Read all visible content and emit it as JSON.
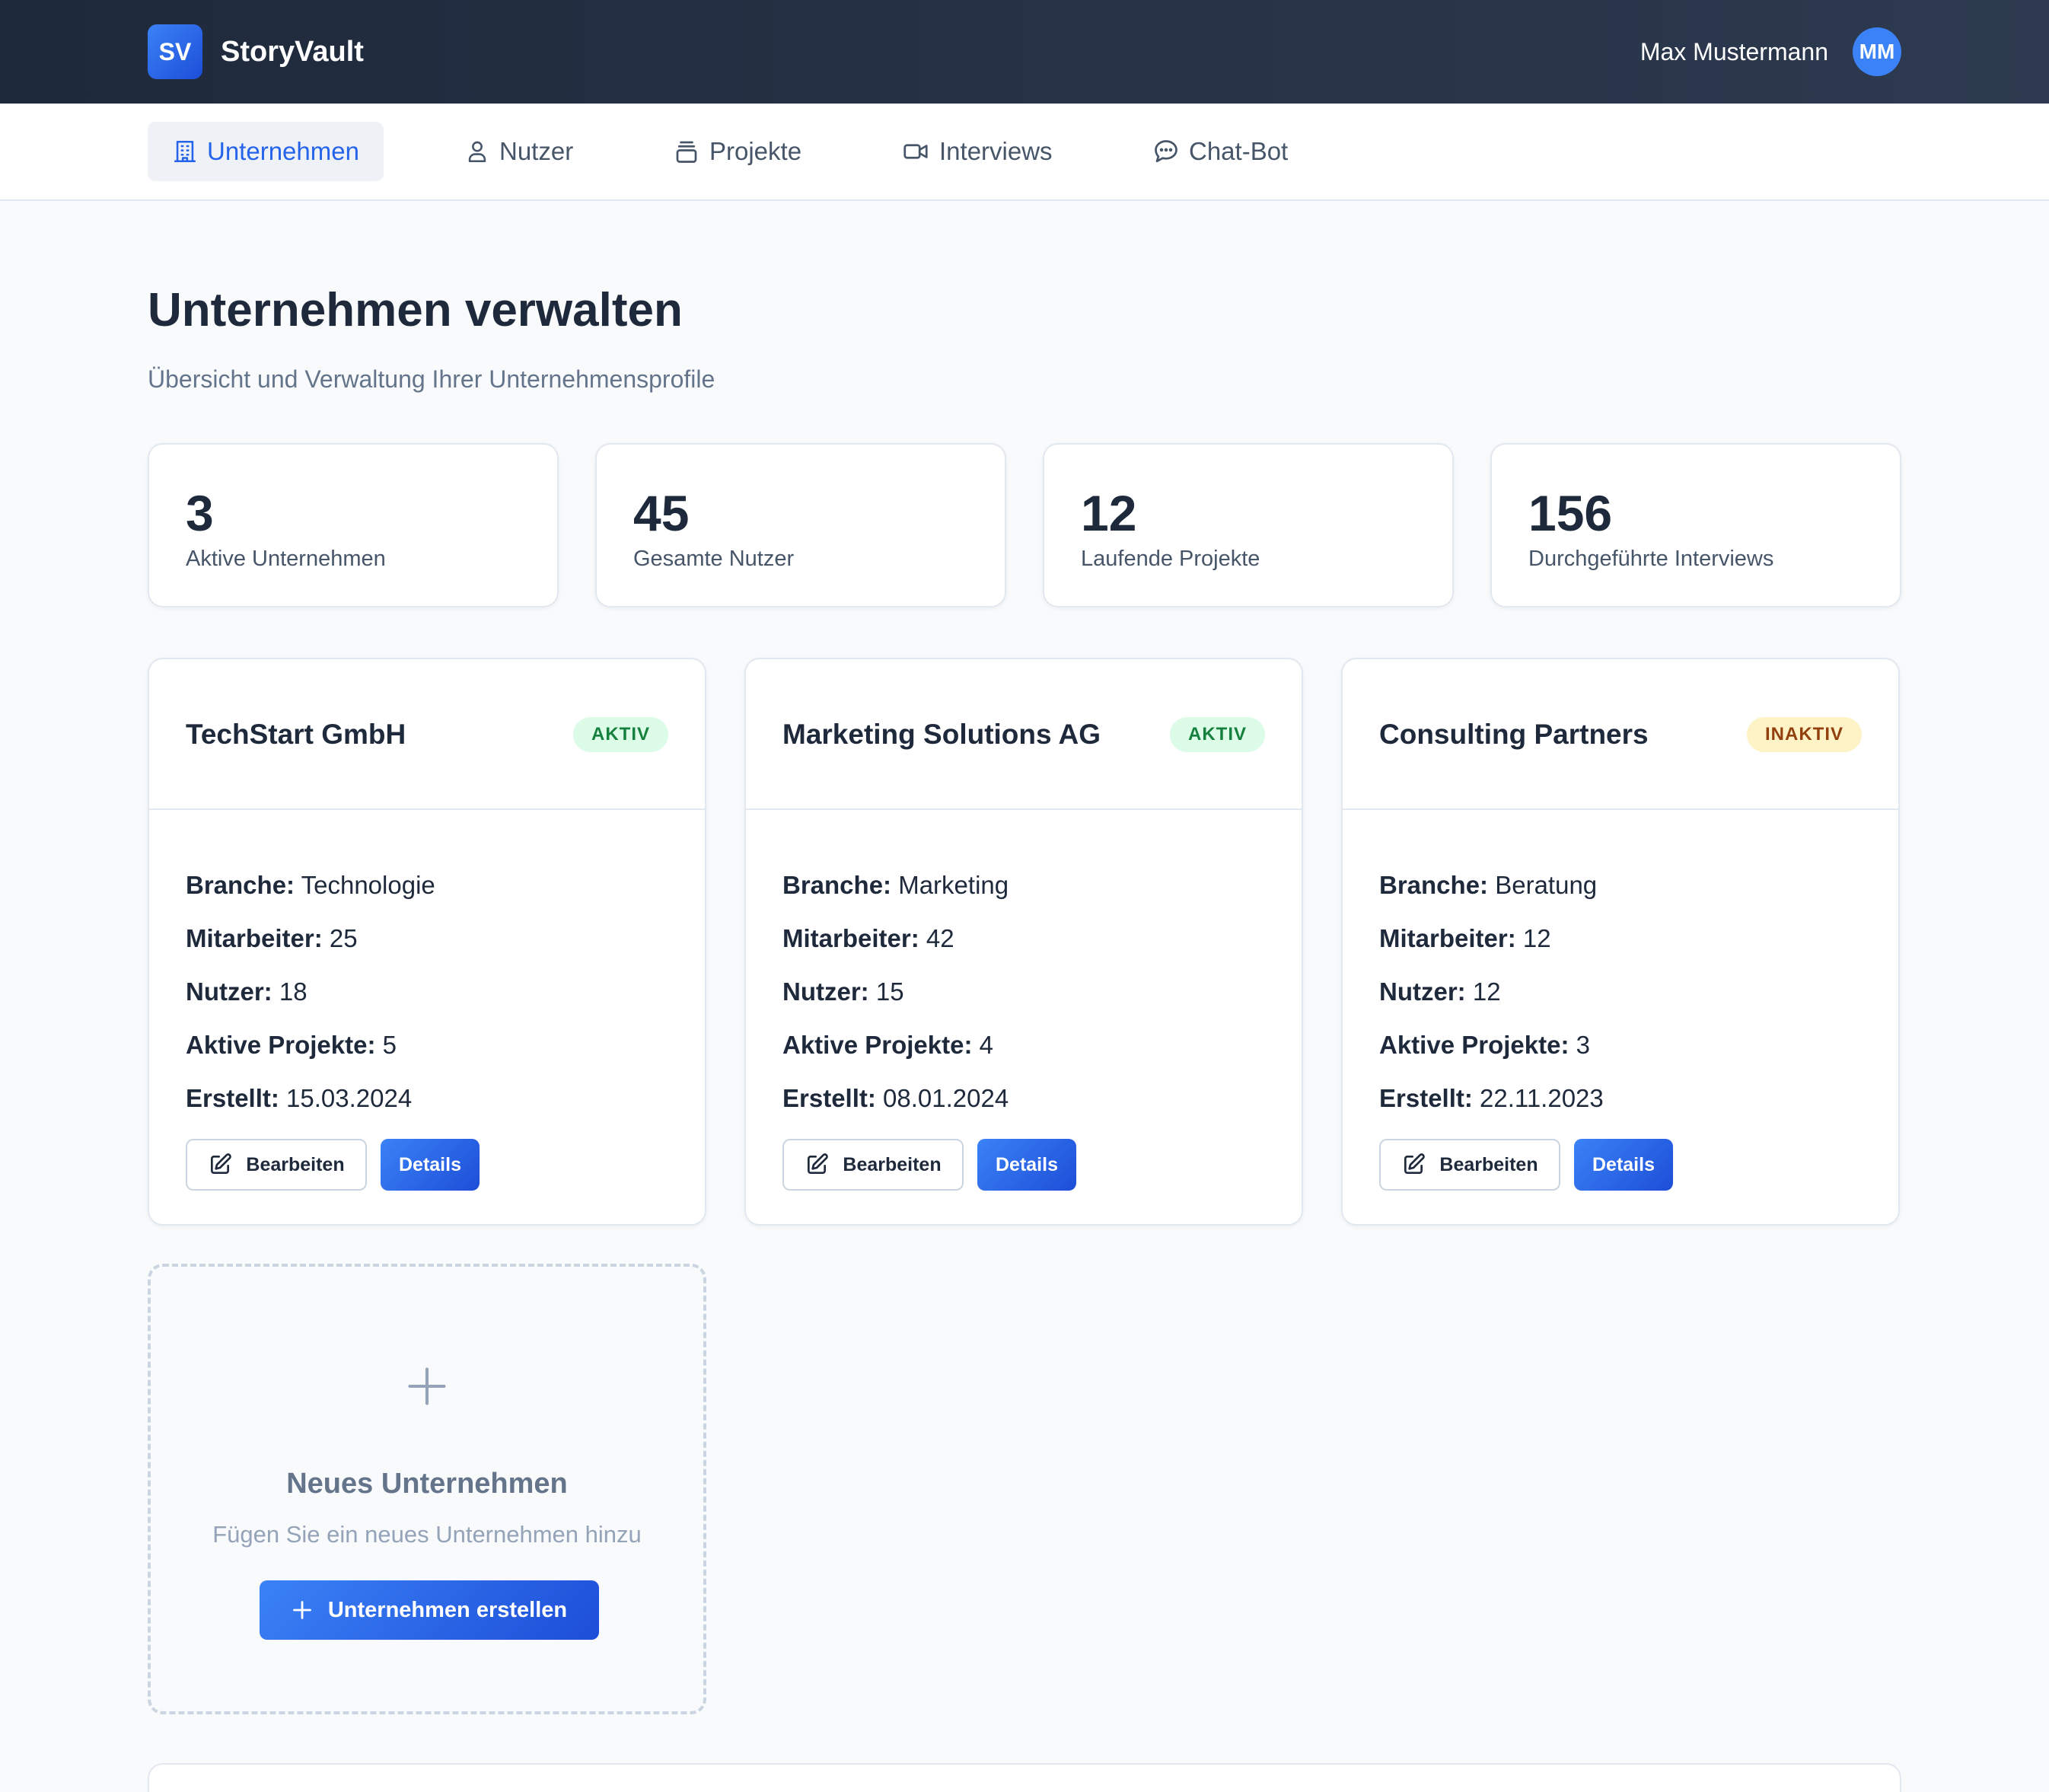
{
  "header": {
    "logo_text": "SV",
    "app_name": "StoryVault",
    "user_name": "Max Mustermann",
    "user_initials": "MM"
  },
  "nav": {
    "tabs": [
      {
        "label": "Unternehmen",
        "icon": "building-icon",
        "active": true
      },
      {
        "label": "Nutzer",
        "icon": "user-icon",
        "active": false
      },
      {
        "label": "Projekte",
        "icon": "archive-icon",
        "active": false
      },
      {
        "label": "Interviews",
        "icon": "video-icon",
        "active": false
      },
      {
        "label": "Chat-Bot",
        "icon": "chat-bubble-icon",
        "active": false
      }
    ]
  },
  "page": {
    "title": "Unternehmen verwalten",
    "subtitle": "Übersicht und Verwaltung Ihrer Unternehmensprofile"
  },
  "stats": [
    {
      "value": "3",
      "label": "Aktive Unternehmen"
    },
    {
      "value": "45",
      "label": "Gesamte Nutzer"
    },
    {
      "value": "12",
      "label": "Laufende Projekte"
    },
    {
      "value": "156",
      "label": "Durchgeführte Interviews"
    }
  ],
  "companies": [
    {
      "name": "TechStart GmbH",
      "status": "AKTIV",
      "branche_label": "Branche:",
      "branche": "Technologie",
      "mitarbeiter_label": "Mitarbeiter:",
      "mitarbeiter": "25",
      "nutzer_label": "Nutzer:",
      "nutzer": "18",
      "projekte_label": "Aktive Projekte:",
      "projekte": "5",
      "erstellt_label": "Erstellt:",
      "erstellt": "15.03.2024",
      "edit_label": "Bearbeiten",
      "details_label": "Details"
    },
    {
      "name": "Marketing Solutions AG",
      "status": "AKTIV",
      "branche_label": "Branche:",
      "branche": "Marketing",
      "mitarbeiter_label": "Mitarbeiter:",
      "mitarbeiter": "42",
      "nutzer_label": "Nutzer:",
      "nutzer": "15",
      "projekte_label": "Aktive Projekte:",
      "projekte": "4",
      "erstellt_label": "Erstellt:",
      "erstellt": "08.01.2024",
      "edit_label": "Bearbeiten",
      "details_label": "Details"
    },
    {
      "name": "Consulting Partners",
      "status": "INAKTIV",
      "branche_label": "Branche:",
      "branche": "Beratung",
      "mitarbeiter_label": "Mitarbeiter:",
      "mitarbeiter": "12",
      "nutzer_label": "Nutzer:",
      "nutzer": "12",
      "projekte_label": "Aktive Projekte:",
      "projekte": "3",
      "erstellt_label": "Erstellt:",
      "erstellt": "22.11.2023",
      "edit_label": "Bearbeiten",
      "details_label": "Details"
    }
  ],
  "new_company": {
    "title": "Neues Unternehmen",
    "subtitle": "Fügen Sie ein neues Unternehmen hinzu",
    "button_label": "Unternehmen erstellen"
  },
  "colors": {
    "accent": "#2563eb",
    "header_bg": "#1e293b",
    "status_active_bg": "#dcfce7",
    "status_active_text": "#15803d",
    "status_inactive_bg": "#fef3c7",
    "status_inactive_text": "#92400e"
  }
}
